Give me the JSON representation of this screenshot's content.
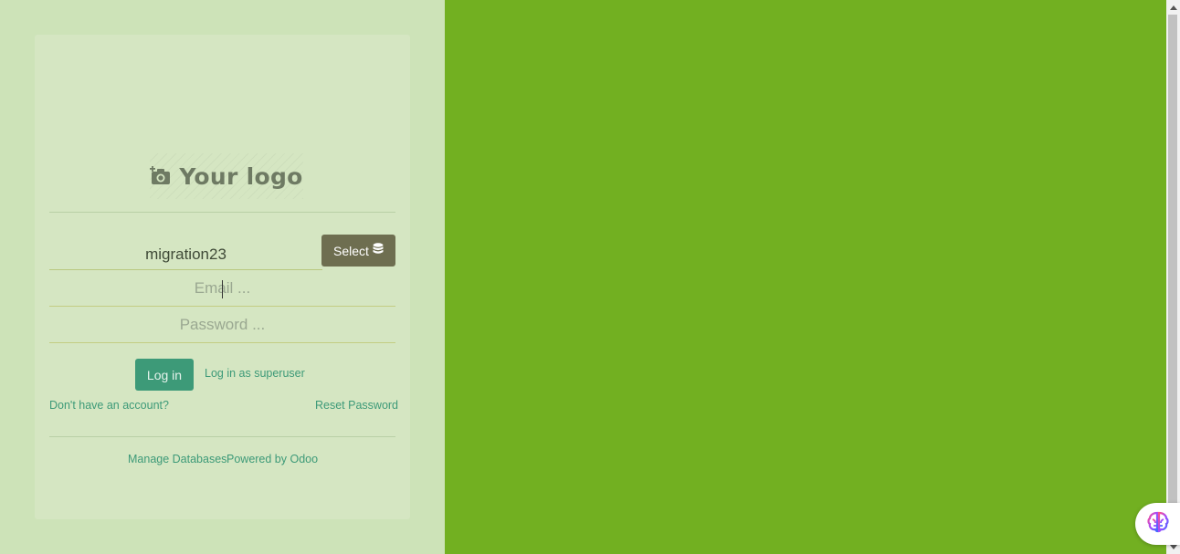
{
  "brand": {
    "logo_text": "Your logo",
    "logo_icon": "camera-add-icon"
  },
  "login_form": {
    "database": {
      "value": "migration23",
      "select_label": "Select",
      "select_icon": "database-icon"
    },
    "email": {
      "value": "",
      "placeholder": "Email ..."
    },
    "password": {
      "value": "",
      "placeholder": "Password ..."
    },
    "login_label": "Log in",
    "superuser_label": "Log in as superuser",
    "signup_label": "Don't have an account?",
    "reset_label": "Reset Password"
  },
  "footer": {
    "manage_label": "Manage Databases",
    "powered_label": "Powered by Odoo"
  },
  "colors": {
    "page_background": "#72b021",
    "panel_background": "#cde3b8",
    "card_background": "#d5e6c2",
    "primary_button": "#3d9a78",
    "select_button": "#6e6e50",
    "link": "#3d9a78"
  },
  "floating_widget": {
    "icon": "brain-icon"
  }
}
